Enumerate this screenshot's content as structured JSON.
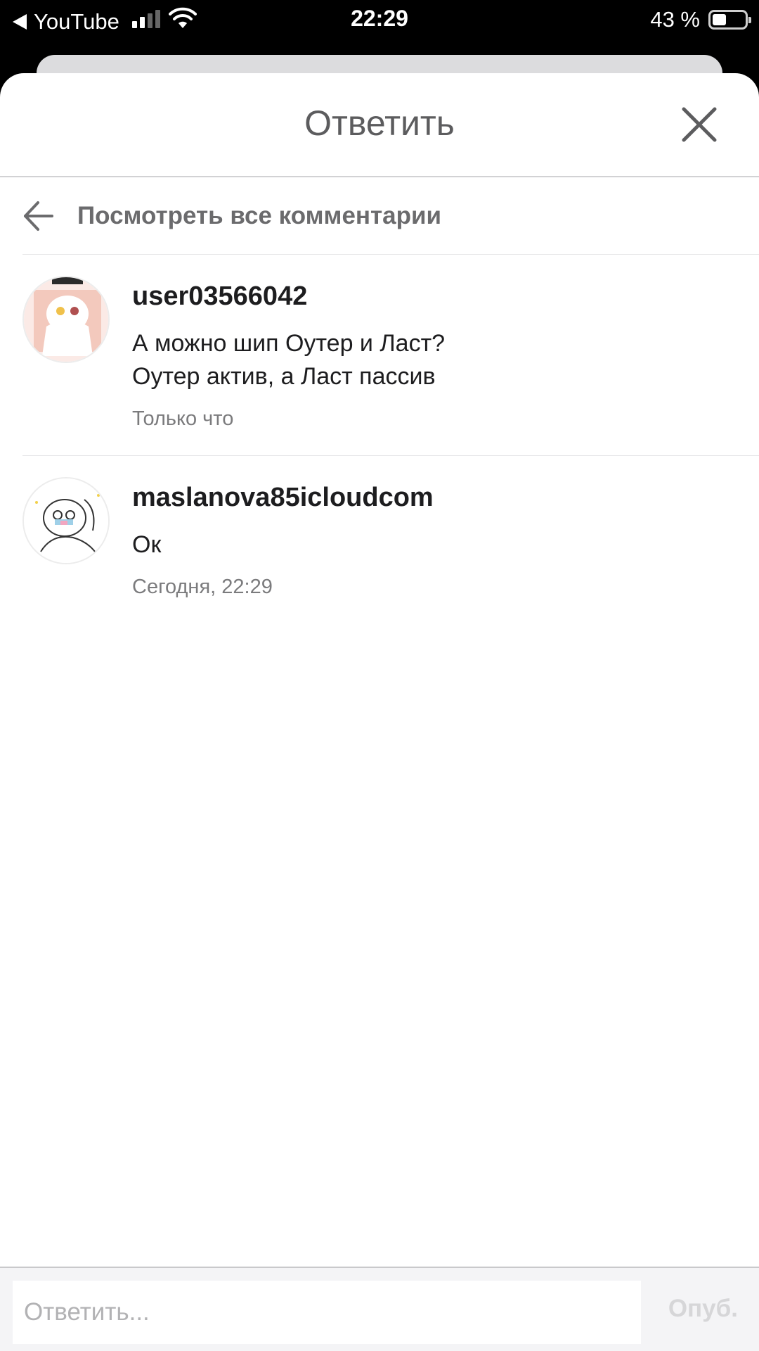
{
  "status_bar": {
    "back_app": "YouTube",
    "time": "22:29",
    "battery": "43 %",
    "battery_level": 0.43,
    "signal_bars_active": 2,
    "signal_bars_total": 4
  },
  "sheet": {
    "title": "Ответить",
    "view_all_label": "Посмотреть все комментарии"
  },
  "comments": [
    {
      "username": "user03566042",
      "text_line1": "А можно шип Оутер и Ласт?",
      "text_line2": "Оутер актив, а Ласт пассив",
      "time": "Только что"
    },
    {
      "username": "maslanova85icloudcom",
      "text_line1": "Ок",
      "time": "Сегодня, 22:29"
    }
  ],
  "reply": {
    "placeholder": "Ответить...",
    "publish_label": "Опуб."
  },
  "colors": {
    "title_gray": "#5c5c5e",
    "text_dark": "#1d1d1f",
    "muted": "#7b7b7d",
    "publish_disabled": "#d6d6d8"
  }
}
